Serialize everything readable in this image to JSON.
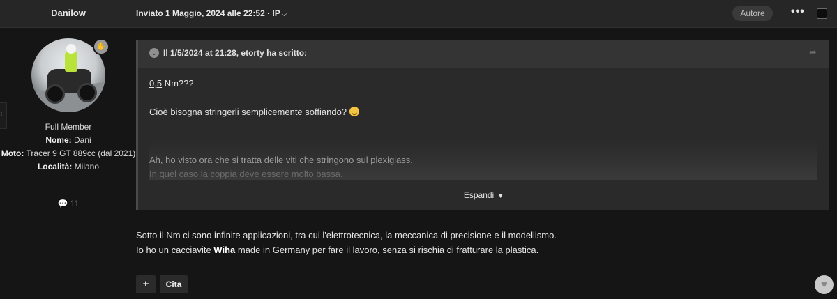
{
  "header": {
    "author_name": "Danilow",
    "posted": "Inviato 1 Maggio, 2024 alle 22:52 · IP",
    "badge": "Autore",
    "more": "•••"
  },
  "user": {
    "rank": "Full Member",
    "name_label": "Nome:",
    "name_value": "Dani",
    "moto_label": "Moto:",
    "moto_value": "Tracer 9 GT 889cc (dal 2021)",
    "location_label": "Località:",
    "location_value": "Milano",
    "post_count": "11"
  },
  "quote": {
    "header": "Il 1/5/2024 at 21:28, etorty ha scritto:",
    "line1_underlined": "0,5",
    "line1_rest": " Nm???",
    "line2": "Cioè bisogna stringerli semplicemente soffiando?",
    "faded1": "Ah, ho visto ora che si tratta delle viti che stringono sul plexiglass.",
    "faded2": "In quel caso la coppia deve essere molto bassa.",
    "expand_label": "Espandi"
  },
  "post": {
    "line1": "Sotto il Nm ci sono infinite applicazioni, tra cui l'elettrotecnica, la meccanica di precisione e il modellismo.",
    "line2_before": "Io ho un cacciavite ",
    "line2_link": "Wiha",
    "line2_after": " made in Germany per fare il lavoro, senza si rischia di fratturare la plastica."
  },
  "actions": {
    "plus": "+",
    "cita": "Cita"
  }
}
